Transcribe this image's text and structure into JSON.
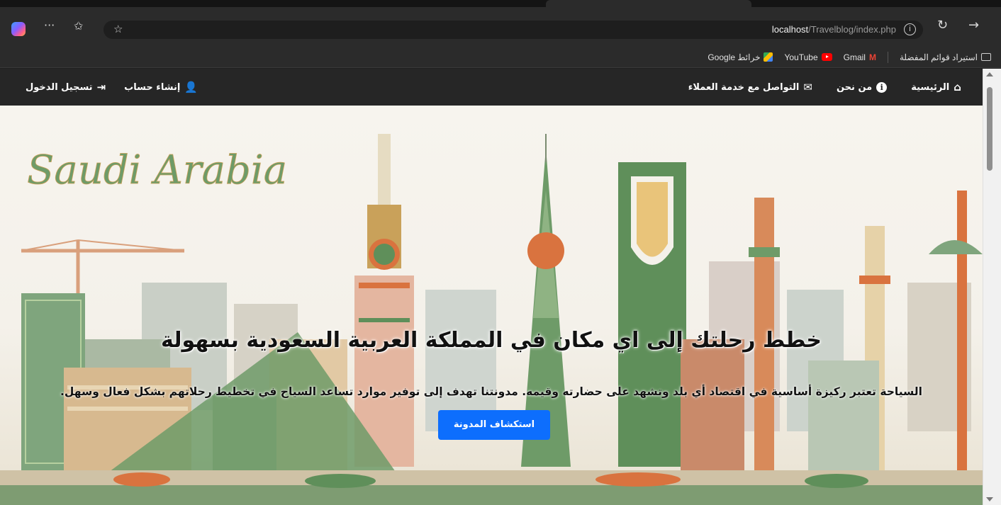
{
  "browser": {
    "address": {
      "host": "localhost",
      "path": "/Travelblog/index.php"
    },
    "bookmarks": [
      {
        "label": "استيراد قوائم المفضلة",
        "icon": "folder-icon"
      },
      {
        "label": "Gmail",
        "icon": "gmail-icon"
      },
      {
        "label": "YouTube",
        "icon": "youtube-icon"
      },
      {
        "label": "خرائط Google",
        "icon": "maps-icon"
      }
    ]
  },
  "navbar": {
    "right": [
      {
        "label": "الرئيسية",
        "icon": "home-icon"
      },
      {
        "label": "من نحن",
        "icon": "info-circle-icon"
      },
      {
        "label": "التواصل مع خدمة العملاء",
        "icon": "envelope-icon"
      }
    ],
    "left": [
      {
        "label": "إنشاء حساب",
        "icon": "user-plus-icon"
      },
      {
        "label": "تسجيل الدخول",
        "icon": "sign-in-icon"
      }
    ]
  },
  "hero": {
    "logo_text": "Saudi Arabia",
    "title": "خطط رحلتك إلى اي مكان في المملكة العربية السعودية بسهولة",
    "subtitle": "السياحة تعتبر ركيزة أساسية في اقتصاد أي بلد وتشهد على حضارته وقيمه. مدونتنا تهدف إلى توفير موارد تساعد السياح في تخطيط رحلاتهم بشكل فعال وسهل.",
    "cta_label": "استكشاف المدونة"
  },
  "colors": {
    "navbar_bg": "#262626",
    "cta_bg": "#0d6efd",
    "accent_green": "#5f8f5a",
    "accent_orange": "#d9733f"
  }
}
